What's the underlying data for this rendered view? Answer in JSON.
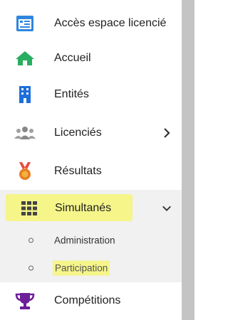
{
  "menu": {
    "items": [
      {
        "label": "Accès espace licencié",
        "icon": "id-card-icon",
        "color": "#2e86de"
      },
      {
        "label": "Accueil",
        "icon": "home-icon",
        "color": "#27ae60"
      },
      {
        "label": "Entités",
        "icon": "building-icon",
        "color": "#1e6fd9"
      },
      {
        "label": "Licenciés",
        "icon": "users-icon",
        "color": "#888888"
      },
      {
        "label": "Résultats",
        "icon": "medal-icon",
        "color": "#e67e22"
      },
      {
        "label": "Simultanés",
        "icon": "grid-icon",
        "color": "#444444"
      },
      {
        "label": "Compétitions",
        "icon": "trophy-icon",
        "color": "#6c1f99"
      }
    ],
    "submenu": {
      "administration": "Administration",
      "participation": "Participation"
    },
    "highlight_color": "#f5f58a"
  }
}
